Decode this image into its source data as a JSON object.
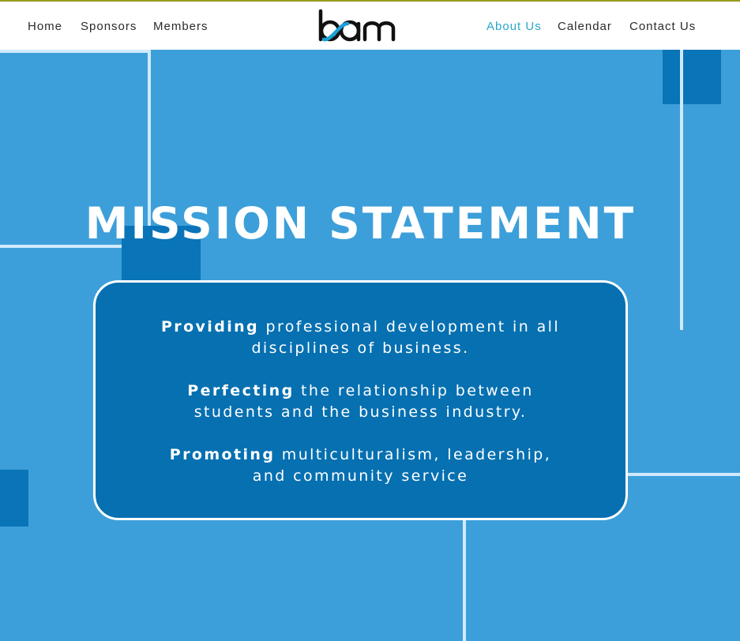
{
  "header": {
    "nav_left": [
      {
        "label": "Home"
      },
      {
        "label": "Sponsors"
      },
      {
        "label": "Members"
      }
    ],
    "logo_text": "bam",
    "nav_right": [
      {
        "label": "About Us",
        "active": true
      },
      {
        "label": "Calendar",
        "active": false
      },
      {
        "label": "Contact Us",
        "active": false
      }
    ]
  },
  "hero": {
    "title": "MISSION STATEMENT",
    "statements": [
      {
        "lead": "Providing",
        "line1_rest": "professional development in all",
        "line2": "disciplines of business."
      },
      {
        "lead": "Perfecting",
        "line1_rest": "the relationship between",
        "line2": "students and the business industry."
      },
      {
        "lead": "Promoting",
        "line1_rest": "multiculturalism, leadership,",
        "line2": "and community service"
      }
    ]
  },
  "colors": {
    "background": "#3d9fd9",
    "card": "#0670b1",
    "accent_nav": "#2aa6c9",
    "logo_swoosh": "#1aa0d8"
  }
}
